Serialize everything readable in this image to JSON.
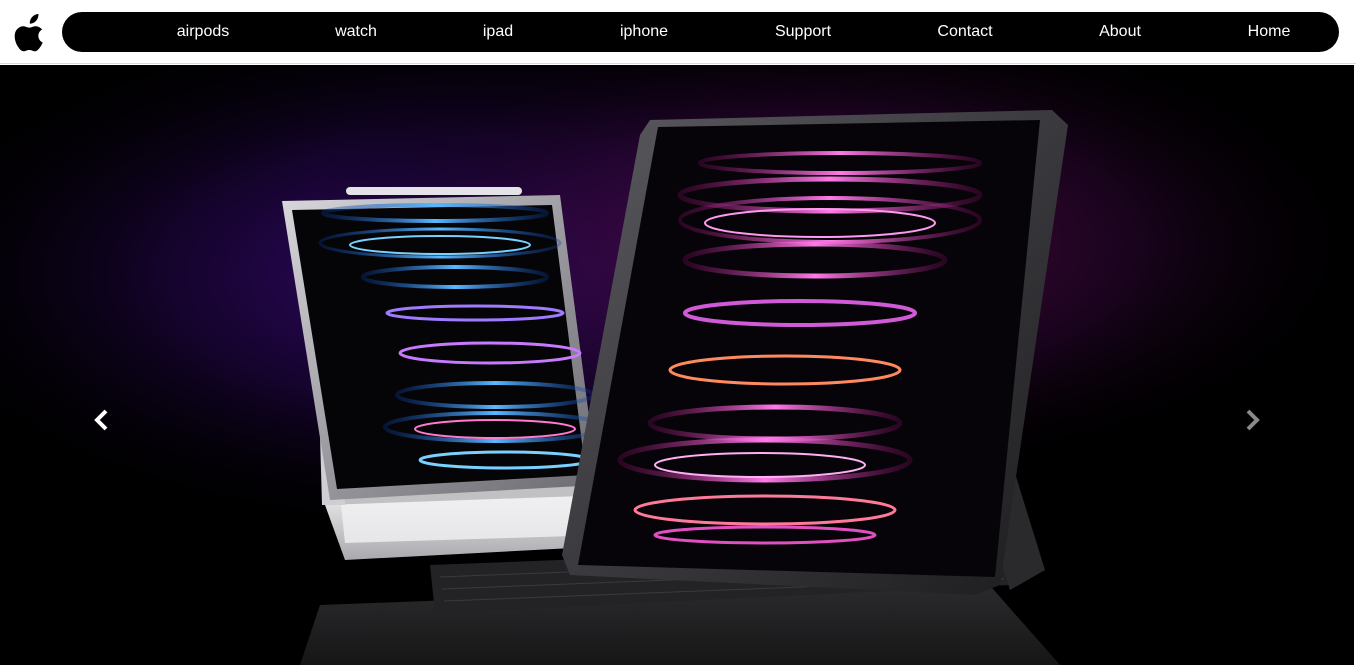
{
  "logo": {
    "icon": "apple-logo-icon"
  },
  "nav": {
    "links": [
      {
        "label": "airpods"
      },
      {
        "label": "watch"
      },
      {
        "label": "ipad"
      },
      {
        "label": "iphone"
      },
      {
        "label": "Support"
      },
      {
        "label": "Contact"
      },
      {
        "label": "About"
      },
      {
        "label": "Home"
      }
    ]
  },
  "carousel": {
    "prev_icon": "chevron-left-icon",
    "next_icon": "chevron-right-icon",
    "slide_image": "ipad-pro-keyboard-image"
  },
  "colors": {
    "nav_bg": "#000000",
    "nav_text": "#ffffff",
    "hero_bg": "#000000",
    "glow_purple": "#3a0a6a",
    "glow_magenta": "#5a0a4a"
  }
}
